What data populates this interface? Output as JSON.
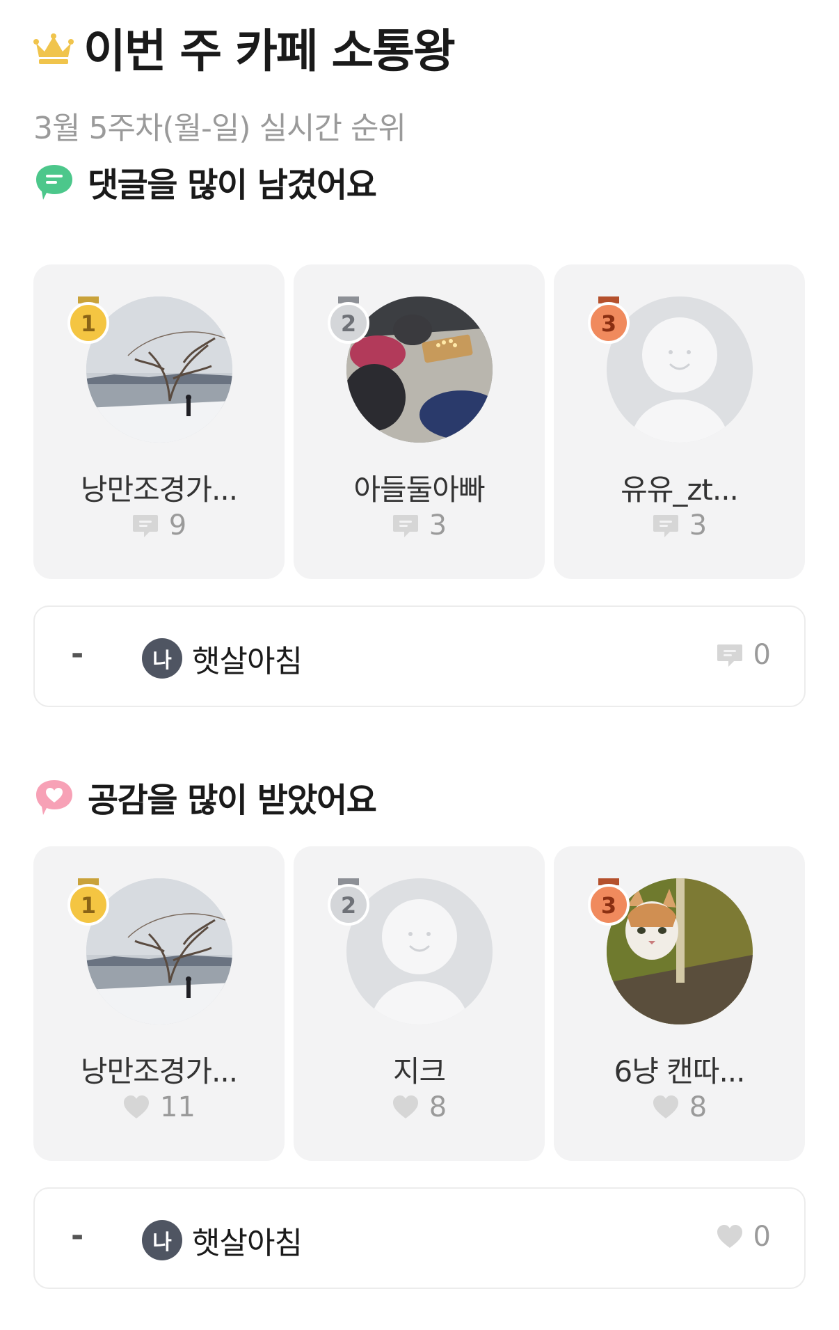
{
  "header": {
    "title": "이번 주 카페 소통왕",
    "subtitle": "3월 5주차(월-일) 실시간 순위",
    "crown_icon": "crown-icon"
  },
  "colors": {
    "gold": "#f4c542",
    "silver": "#c8cacd",
    "bronze": "#e2703f",
    "card_bg": "#f3f3f4",
    "comment_green": "#4cc78b",
    "heart_pink": "#f7a1b6",
    "stat_gray": "#d6d6d6"
  },
  "comments_section": {
    "title": "댓글을 많이 남겼어요",
    "icon": "chat-bubble-icon",
    "stat_icon": "comment-icon",
    "ranks": [
      {
        "rank": "1",
        "name": "낭만조경가...",
        "count": "9",
        "avatar": "lake-tree-photo"
      },
      {
        "rank": "2",
        "name": "아들둘아빠",
        "count": "3",
        "avatar": "camping-photo"
      },
      {
        "rank": "3",
        "name": "유유_zt...",
        "count": "3",
        "avatar": "default-profile"
      }
    ],
    "me": {
      "rank": "-",
      "badge": "나",
      "name": "햇살아침",
      "count": "0"
    }
  },
  "likes_section": {
    "title": "공감을 많이 받았어요",
    "icon": "heart-bubble-icon",
    "stat_icon": "heart-icon",
    "ranks": [
      {
        "rank": "1",
        "name": "낭만조경가...",
        "count": "11",
        "avatar": "lake-tree-photo"
      },
      {
        "rank": "2",
        "name": "지크",
        "count": "8",
        "avatar": "default-profile"
      },
      {
        "rank": "3",
        "name": "6냥 캔따...",
        "count": "8",
        "avatar": "cat-photo"
      }
    ],
    "me": {
      "rank": "-",
      "badge": "나",
      "name": "햇살아침",
      "count": "0"
    }
  }
}
